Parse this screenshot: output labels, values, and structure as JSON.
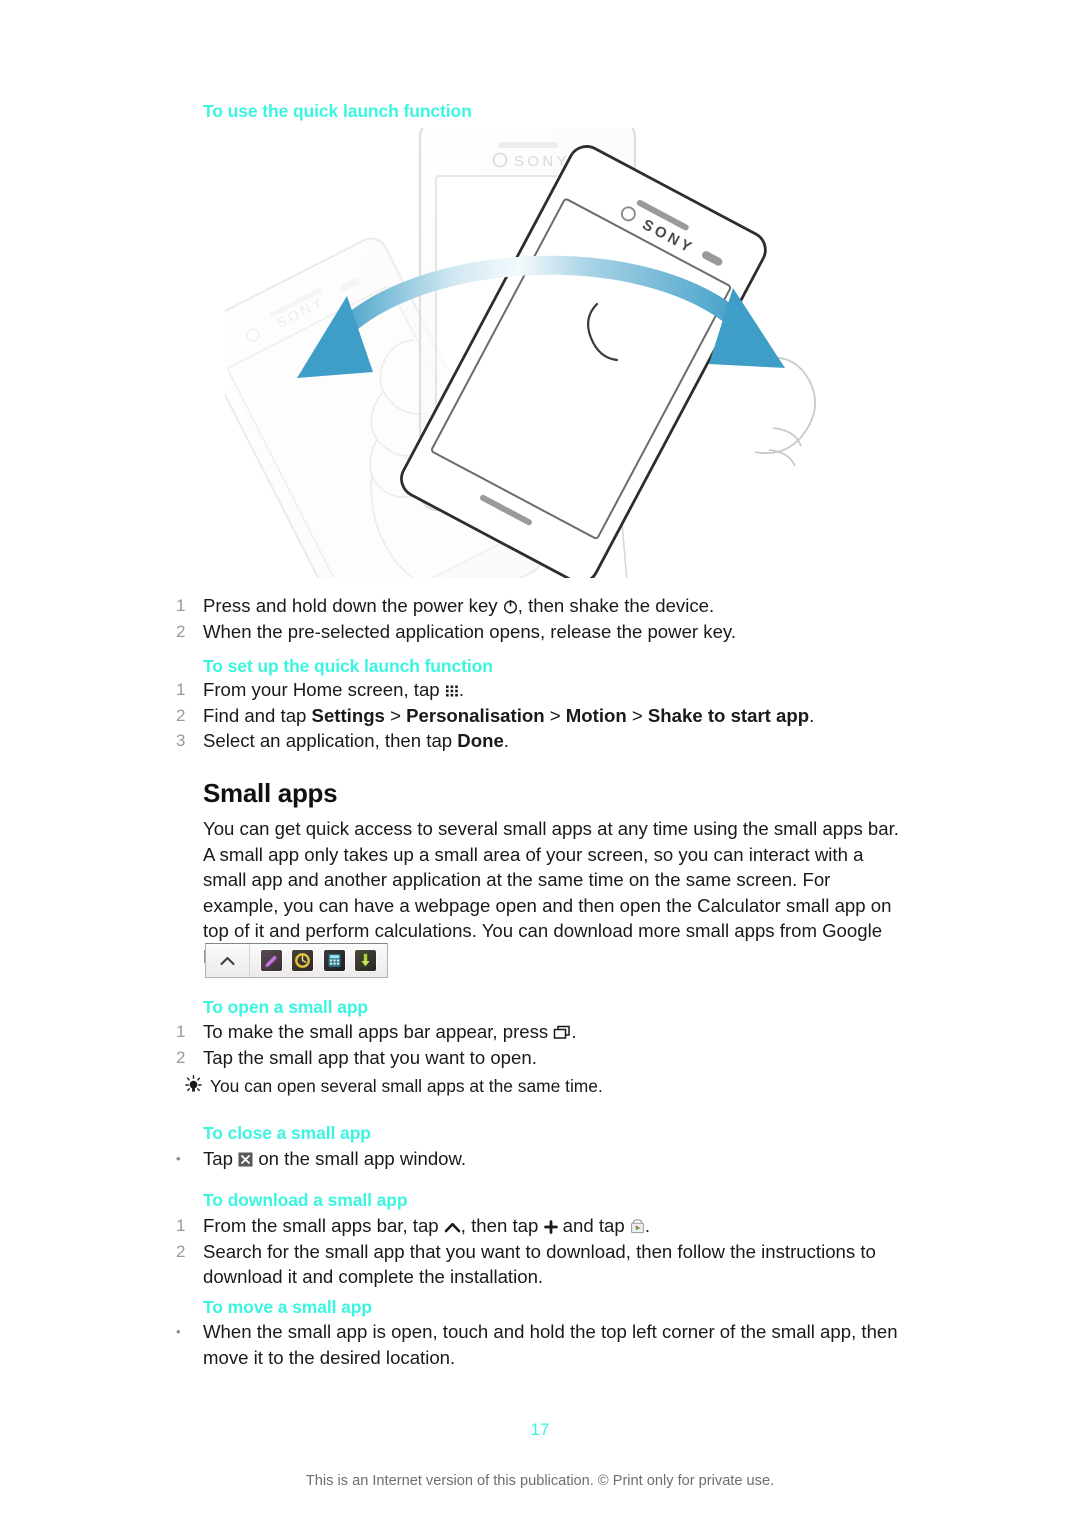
{
  "page": {
    "number": "17",
    "footer_note": "This is an Internet version of this publication. © Print only for private use."
  },
  "sections": [
    {
      "heading": "To use the quick launch function",
      "steps": [
        {
          "marker": "1",
          "pre": "Press and hold down the power key ",
          "icon": "power-icon",
          "post": ", then shake the device."
        },
        {
          "marker": "2",
          "text": "When the pre-selected application opens, release the power key."
        }
      ]
    },
    {
      "heading": "To set up the quick launch function",
      "steps": [
        {
          "marker": "1",
          "pre": "From your Home screen, tap ",
          "icon": "apps-grid-icon",
          "post": "."
        },
        {
          "marker": "2",
          "text": "Find and tap Settings > Personalisation > Motion > Shake to start app."
        },
        {
          "marker": "3",
          "text": "Select an application, then tap Done."
        }
      ]
    }
  ],
  "setup_step2": {
    "lead": "Find and tap ",
    "b1": "Settings",
    "sep1": " > ",
    "b2": "Personalisation",
    "sep2": " > ",
    "b3": "Motion",
    "sep3": " > ",
    "b4": "Shake to start app",
    "tail": "."
  },
  "setup_step3": {
    "lead": "Select an application, then tap ",
    "b1": "Done",
    "tail": "."
  },
  "small_apps": {
    "title": "Small apps",
    "body": "You can get quick access to several small apps at any time using the small apps bar. A small app only takes up a small area of your screen, so you can interact with a small app and another application at the same time on the same screen. For example, you can have a webpage open and then open the Calculator small app on top of it and perform calculations. You can download more small apps from Google Play™.",
    "bar": {
      "expand_icon": "chevron-up-icon",
      "icons": [
        {
          "name": "notes-small-app-icon",
          "color": "#b07ec8"
        },
        {
          "name": "timer-small-app-icon",
          "color": "#c9a227"
        },
        {
          "name": "calculator-small-app-icon",
          "color": "#3fb0c9"
        },
        {
          "name": "download-small-app-icon",
          "color": "#8fc020"
        }
      ]
    },
    "open": {
      "heading": "To open a small app",
      "step1_pre": "To make the small apps bar appear, press ",
      "step1_icon": "recent-apps-icon",
      "step1_post": ".",
      "step2": "Tap the small app that you want to open.",
      "tip": "You can open several small apps at the same time."
    },
    "close": {
      "heading": "To close a small app",
      "bullet_pre": "Tap ",
      "bullet_icon": "close-x-icon",
      "bullet_post": " on the small app window."
    },
    "download": {
      "heading": "To download a small app",
      "step1_a": "From the small apps bar, tap ",
      "step1_icon1": "chevron-up-icon",
      "step1_b": ", then tap ",
      "step1_icon2": "plus-icon",
      "step1_c": " and tap ",
      "step1_icon3": "play-store-icon",
      "step1_d": ".",
      "step2": "Search for the small app that you want to download, then follow the instructions to download it and complete the installation."
    },
    "move": {
      "heading": "To move a small app",
      "bullet": "When the small app is open, touch and hold the top left corner of the small app, then move it to the desired location."
    }
  },
  "illustration": {
    "name": "shake-device-illustration",
    "brand": "SONY",
    "arrow_color": "#3f9ec7"
  },
  "colors": {
    "heading_cyan": "#3bf5e0",
    "body_text": "#1a1a1a",
    "marker_gray": "#9a9a9a",
    "footer_gray": "#6e6e6e"
  }
}
